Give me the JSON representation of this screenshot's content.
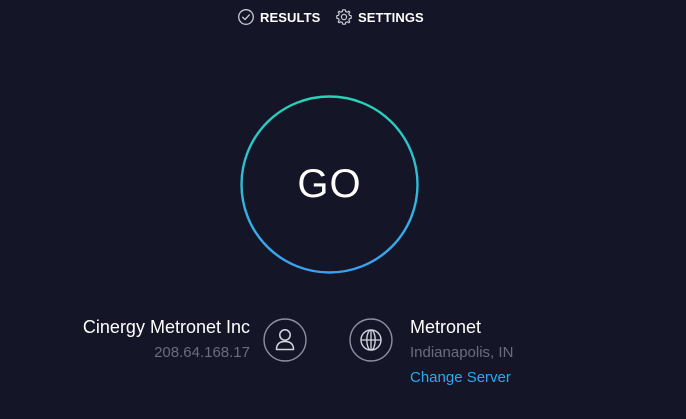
{
  "nav": {
    "results_label": "RESULTS",
    "results_icon": "check-circle-icon",
    "settings_label": "SETTINGS",
    "settings_icon": "gear-icon"
  },
  "go_button": {
    "label": "GO",
    "ring_colors": [
      "#26d3b8",
      "#3ba0f5"
    ]
  },
  "isp": {
    "name": "Cinergy Metronet Inc",
    "ip": "208.64.168.17",
    "icon": "user-icon"
  },
  "server": {
    "name": "Metronet",
    "location": "Indianapolis, IN",
    "change_label": "Change Server",
    "icon": "globe-icon"
  },
  "colors": {
    "background": "#141526",
    "muted_text": "#6b6c80",
    "link": "#2aa9f1"
  }
}
